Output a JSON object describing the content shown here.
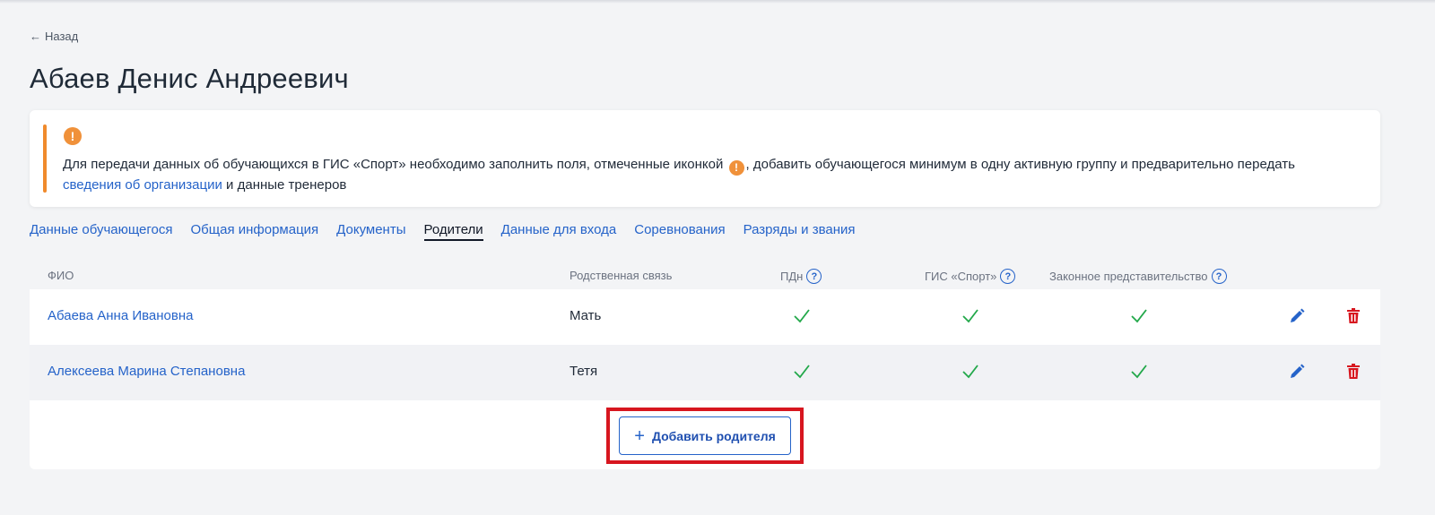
{
  "back": {
    "label": "Назад"
  },
  "title": "Абаев Денис Андреевич",
  "alert": {
    "text_before": "Для передачи данных об обучающихся в ГИС «Спорт» необходимо заполнить поля, отмеченные иконкой",
    "text_after": ", добавить обучающегося минимум в одну активную группу и предварительно передать",
    "link": "сведения об организации",
    "text_end": "и данные тренеров"
  },
  "tabs": [
    {
      "label": "Данные обучающегося",
      "active": false
    },
    {
      "label": "Общая информация",
      "active": false
    },
    {
      "label": "Документы",
      "active": false
    },
    {
      "label": "Родители",
      "active": true
    },
    {
      "label": "Данные для входа",
      "active": false
    },
    {
      "label": "Соревнования",
      "active": false
    },
    {
      "label": "Разряды и звания",
      "active": false
    }
  ],
  "table": {
    "headers": {
      "name": "ФИО",
      "relation": "Родственная связь",
      "pdn": "ПДн",
      "gis": "ГИС «Спорт»",
      "legal": "Законное представительство"
    },
    "rows": [
      {
        "name": "Абаева Анна Ивановна",
        "relation": "Мать",
        "pdn": true,
        "gis": true,
        "legal": true
      },
      {
        "name": "Алексеева Марина Степановна",
        "relation": "Тетя",
        "pdn": true,
        "gis": true,
        "legal": true
      }
    ]
  },
  "add_button": {
    "label": "Добавить родителя"
  },
  "colors": {
    "accent": "#2563c9",
    "warning": "#f0913a",
    "success": "#22a84a",
    "danger": "#d7161f"
  },
  "icons": {
    "check": "check-icon",
    "edit": "pencil-icon",
    "delete": "trash-icon",
    "help": "question-circle-icon",
    "warning": "exclamation-circle-icon"
  }
}
